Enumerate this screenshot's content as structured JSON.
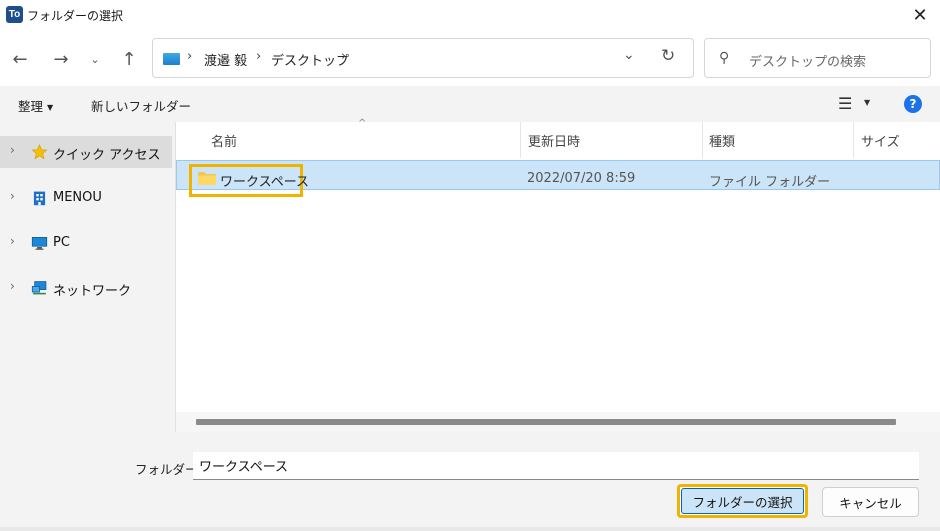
{
  "window": {
    "app_icon_text": "To",
    "title": "フォルダーの選択"
  },
  "navigation": {
    "back": "back",
    "forward": "forward",
    "recent": "recent-locations",
    "up": "up"
  },
  "address_bar": {
    "crumbs": [
      "渡邉 毅",
      "デスクトップ"
    ],
    "separator": "›"
  },
  "search": {
    "placeholder": "デスクトップの検索"
  },
  "toolbar": {
    "organize": "整理",
    "new_folder": "新しいフォルダー"
  },
  "sidebar": {
    "items": [
      {
        "label": "クイック アクセス",
        "icon": "star-icon",
        "selected": true
      },
      {
        "label": "MENOU",
        "icon": "building-icon",
        "selected": false
      },
      {
        "label": "PC",
        "icon": "monitor-icon",
        "selected": false
      },
      {
        "label": "ネットワーク",
        "icon": "network-icon",
        "selected": false
      }
    ]
  },
  "columns": {
    "name": "名前",
    "modified": "更新日時",
    "type": "種類",
    "size": "サイズ"
  },
  "rows": [
    {
      "name": "ワークスペース",
      "modified": "2022/07/20 8:59",
      "type": "ファイル フォルダー",
      "selected": true
    }
  ],
  "footer": {
    "folder_label": "フォルダー:",
    "folder_value": "ワークスペース",
    "select_button": "フォルダーの選択",
    "cancel_button": "キャンセル"
  },
  "colors": {
    "accent": "#0067c0",
    "selection": "#cce4f7",
    "highlight": "#f0b400"
  }
}
